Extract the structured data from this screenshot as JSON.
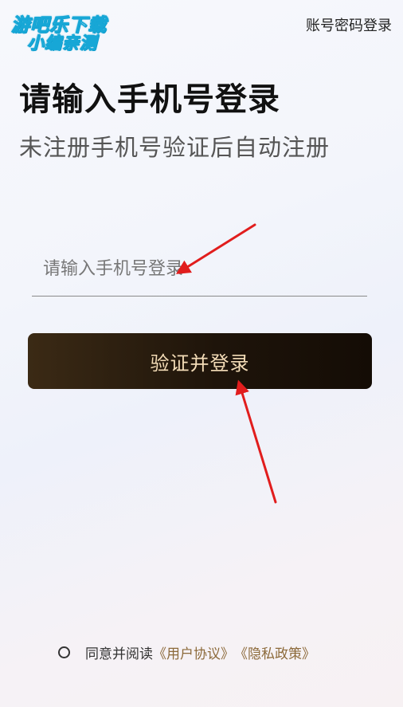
{
  "watermark": {
    "line1": "游吧乐下载",
    "line2": "小编亲测"
  },
  "header": {
    "account_login": "账号密码登录"
  },
  "main": {
    "title": "请输入手机号登录",
    "subtitle": "未注册手机号验证后自动注册",
    "phone_placeholder": "请输入手机号登录",
    "submit_label": "验证并登录"
  },
  "footer": {
    "agree_text": "同意并阅读",
    "user_agreement": "《用户协议》",
    "privacy_policy": "《隐私政策》"
  },
  "colors": {
    "button_bg": "#1e140a",
    "button_text": "#f3dcb7",
    "link": "#8c6a3a",
    "annotation_arrow": "#e11d1d"
  }
}
